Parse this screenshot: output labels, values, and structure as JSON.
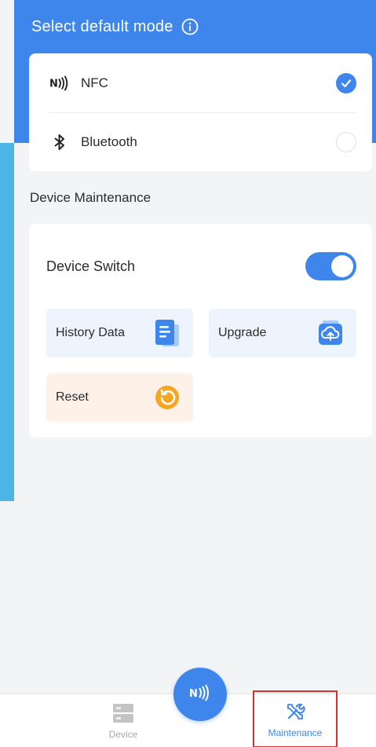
{
  "header": {
    "title": "Select default mode",
    "info_icon": "info-icon"
  },
  "mode": {
    "options": [
      {
        "label": "NFC",
        "icon": "nfc-icon",
        "selected": true
      },
      {
        "label": "Bluetooth",
        "icon": "bluetooth-icon",
        "selected": false
      }
    ]
  },
  "maintenance": {
    "section_title": "Device Maintenance",
    "switch_label": "Device Switch",
    "switch_on": true,
    "tiles": {
      "history": {
        "label": "History Data",
        "icon": "document-icon"
      },
      "upgrade": {
        "label": "Upgrade",
        "icon": "cloud-upload-icon"
      },
      "reset": {
        "label": "Reset",
        "icon": "reset-icon"
      }
    }
  },
  "nav": {
    "device_label": "Device",
    "maintenance_label": "Maintenance",
    "fab_icon": "nfc-icon"
  },
  "colors": {
    "primary": "#3f86ec",
    "accent_orange": "#f5a623",
    "highlight_border": "#d9322e"
  }
}
